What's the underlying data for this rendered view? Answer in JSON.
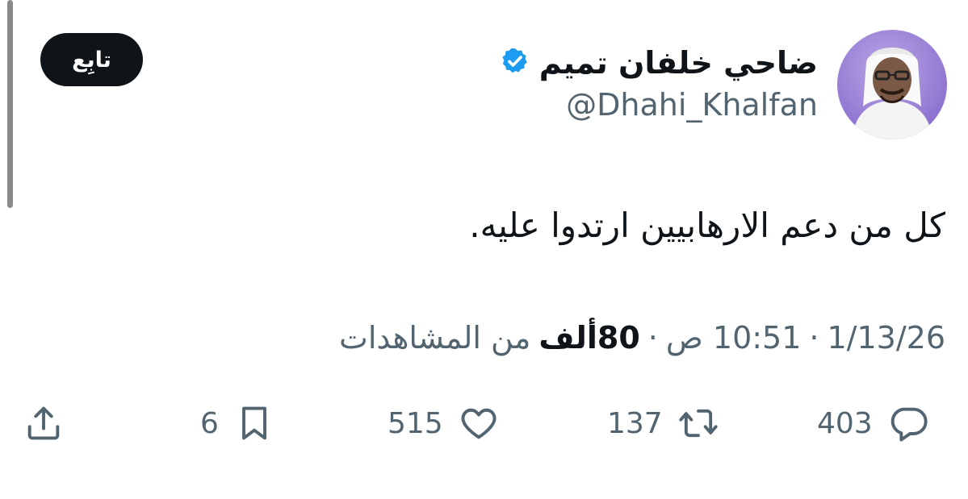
{
  "header": {
    "follow_label": "تابِع",
    "display_name": "ضاحي خلفان تميم",
    "handle": "@Dhahi_Khalfan",
    "verified_color": "#1d9bf0"
  },
  "tweet": {
    "text": "كل من دعم الارهابيين ارتدوا عليه."
  },
  "meta": {
    "date": "1/13/26",
    "separator": "·",
    "time": "10:51 ص",
    "views_count": "80ألف",
    "views_label": "من المشاهدات"
  },
  "actions": {
    "replies": "403",
    "reposts": "137",
    "likes": "515",
    "bookmarks": "6",
    "icons": [
      "reply-icon",
      "repost-icon",
      "like-icon",
      "bookmark-icon",
      "share-icon"
    ]
  }
}
